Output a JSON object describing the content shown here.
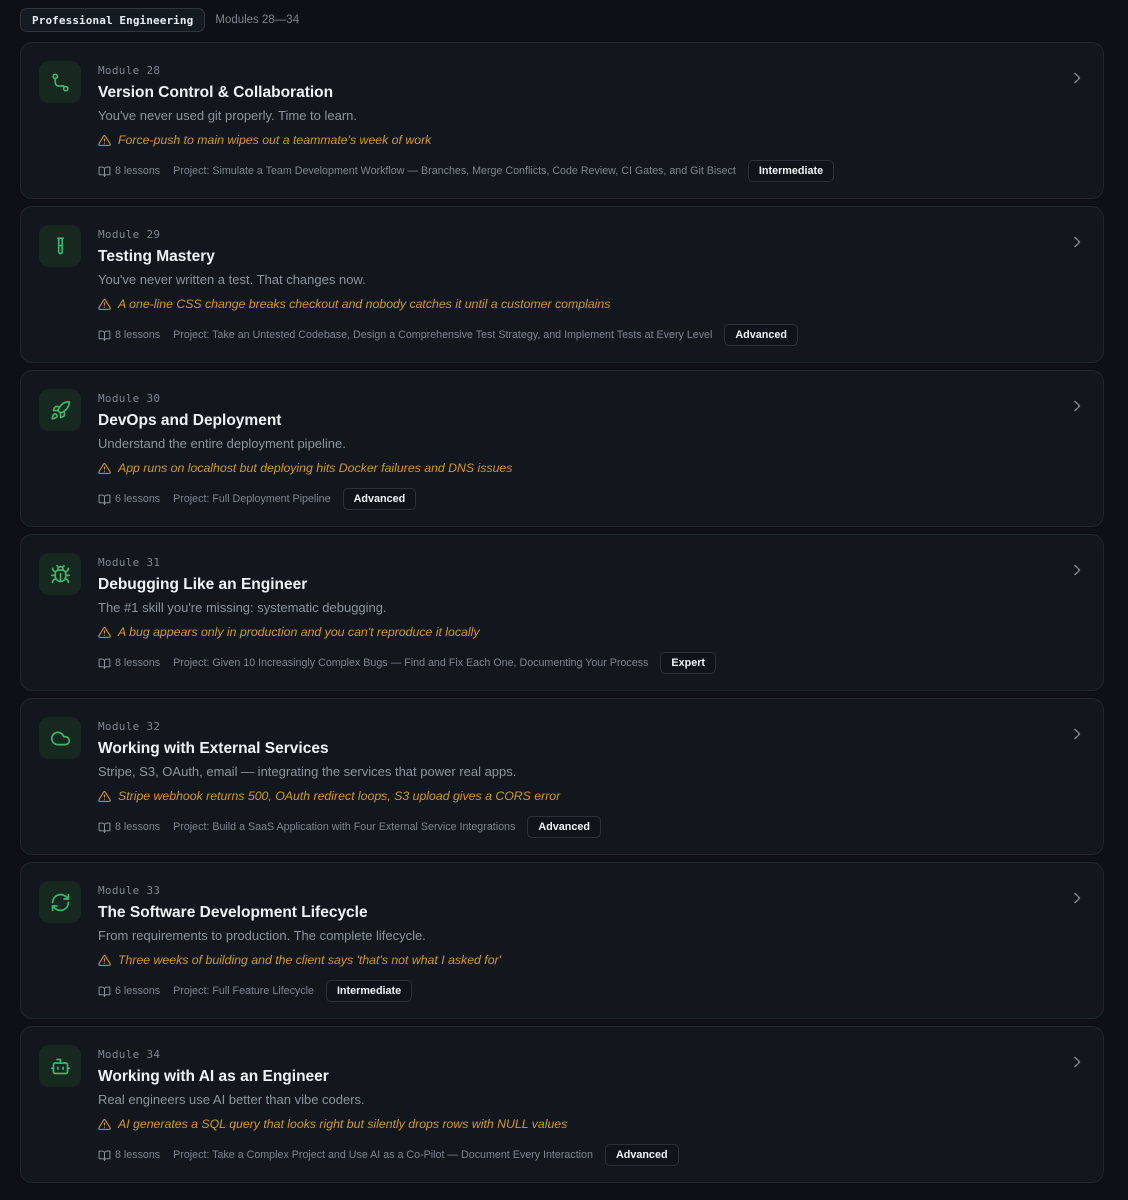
{
  "header": {
    "section": "Professional Engineering",
    "range": "Modules 28—34"
  },
  "colors": {
    "background": "#0d1117",
    "card": "#12171e",
    "accent_green": "#3fb66a",
    "warning_amber": "#d29922"
  },
  "modules": [
    {
      "number": "Module 28",
      "title": "Version Control & Collaboration",
      "subtitle": "You've never used git properly. Time to learn.",
      "warning": "Force-push to main wipes out a teammate's week of work",
      "lessons": "8 lessons",
      "project": "Project: Simulate a Team Development Workflow — Branches, Merge Conflicts, Code Review, CI Gates, and Git Bisect",
      "level": "Intermediate",
      "icon": "git-branch-icon"
    },
    {
      "number": "Module 29",
      "title": "Testing Mastery",
      "subtitle": "You've never written a test. That changes now.",
      "warning": "A one-line CSS change breaks checkout and nobody catches it until a customer complains",
      "lessons": "8 lessons",
      "project": "Project: Take an Untested Codebase, Design a Comprehensive Test Strategy, and Implement Tests at Every Level",
      "level": "Advanced",
      "icon": "test-tube-icon"
    },
    {
      "number": "Module 30",
      "title": "DevOps and Deployment",
      "subtitle": "Understand the entire deployment pipeline.",
      "warning": "App runs on localhost but deploying hits Docker failures and DNS issues",
      "lessons": "6 lessons",
      "project": "Project: Full Deployment Pipeline",
      "level": "Advanced",
      "icon": "rocket-icon"
    },
    {
      "number": "Module 31",
      "title": "Debugging Like an Engineer",
      "subtitle": "The #1 skill you're missing: systematic debugging.",
      "warning": "A bug appears only in production and you can't reproduce it locally",
      "lessons": "8 lessons",
      "project": "Project: Given 10 Increasingly Complex Bugs — Find and Fix Each One, Documenting Your Process",
      "level": "Expert",
      "icon": "bug-icon"
    },
    {
      "number": "Module 32",
      "title": "Working with External Services",
      "subtitle": "Stripe, S3, OAuth, email — integrating the services that power real apps.",
      "warning": "Stripe webhook returns 500, OAuth redirect loops, S3 upload gives a CORS error",
      "lessons": "8 lessons",
      "project": "Project: Build a SaaS Application with Four External Service Integrations",
      "level": "Advanced",
      "icon": "cloud-icon"
    },
    {
      "number": "Module 33",
      "title": "The Software Development Lifecycle",
      "subtitle": "From requirements to production. The complete lifecycle.",
      "warning": "Three weeks of building and the client says 'that's not what I asked for'",
      "lessons": "6 lessons",
      "project": "Project: Full Feature Lifecycle",
      "level": "Intermediate",
      "icon": "refresh-icon"
    },
    {
      "number": "Module 34",
      "title": "Working with AI as an Engineer",
      "subtitle": "Real engineers use AI better than vibe coders.",
      "warning": "AI generates a SQL query that looks right but silently drops rows with NULL values",
      "lessons": "8 lessons",
      "project": "Project: Take a Complex Project and Use AI as a Co-Pilot — Document Every Interaction",
      "level": "Advanced",
      "icon": "bot-icon"
    }
  ]
}
